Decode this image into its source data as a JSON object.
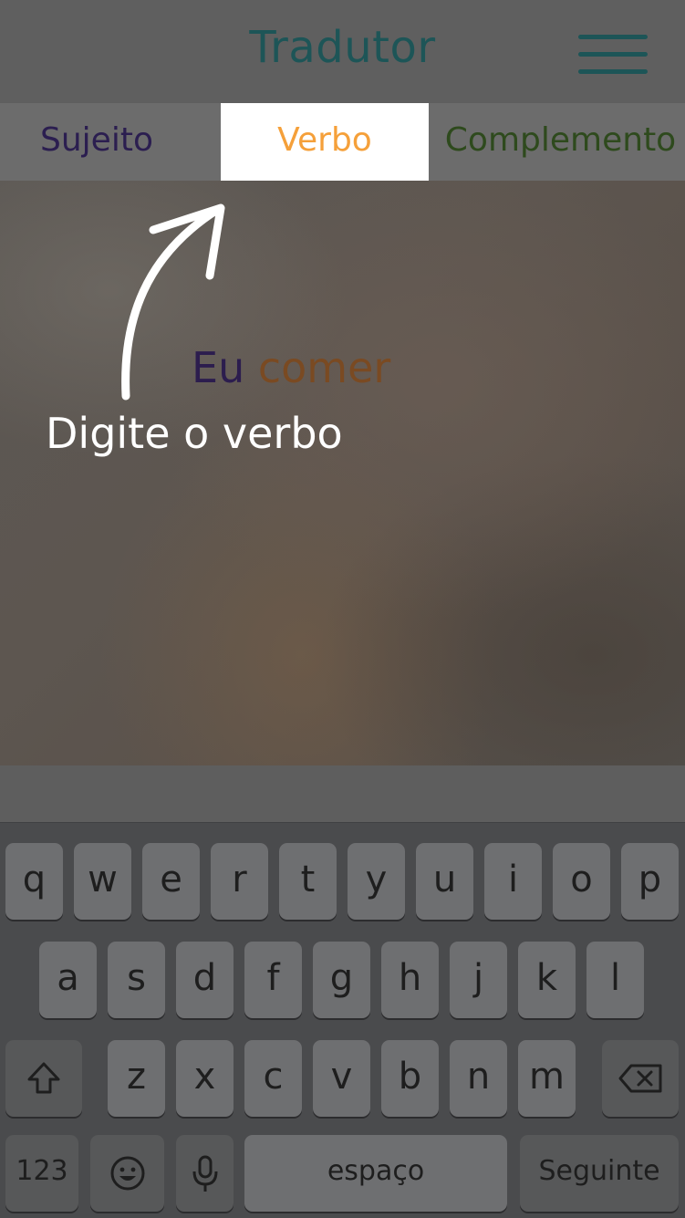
{
  "header": {
    "title": "Tradutor"
  },
  "tabs": [
    {
      "label": "Sujeito"
    },
    {
      "label": "Verbo"
    },
    {
      "label": "Complemento"
    }
  ],
  "sentence": {
    "subject": "Eu",
    "verb": "comer"
  },
  "hint": {
    "text": "Digite o verbo"
  },
  "keyboard": {
    "row1": [
      "q",
      "w",
      "e",
      "r",
      "t",
      "y",
      "u",
      "i",
      "o",
      "p"
    ],
    "row2": [
      "a",
      "s",
      "d",
      "f",
      "g",
      "h",
      "j",
      "k",
      "l"
    ],
    "row3": [
      "z",
      "x",
      "c",
      "v",
      "b",
      "n",
      "m"
    ],
    "numbers_label": "123",
    "space_label": "espaço",
    "return_label": "Seguinte"
  },
  "colors": {
    "accent": "#f5a03a",
    "title": "#1d5557",
    "subject": "#2c1d4e",
    "complement": "#2e4a1d"
  }
}
